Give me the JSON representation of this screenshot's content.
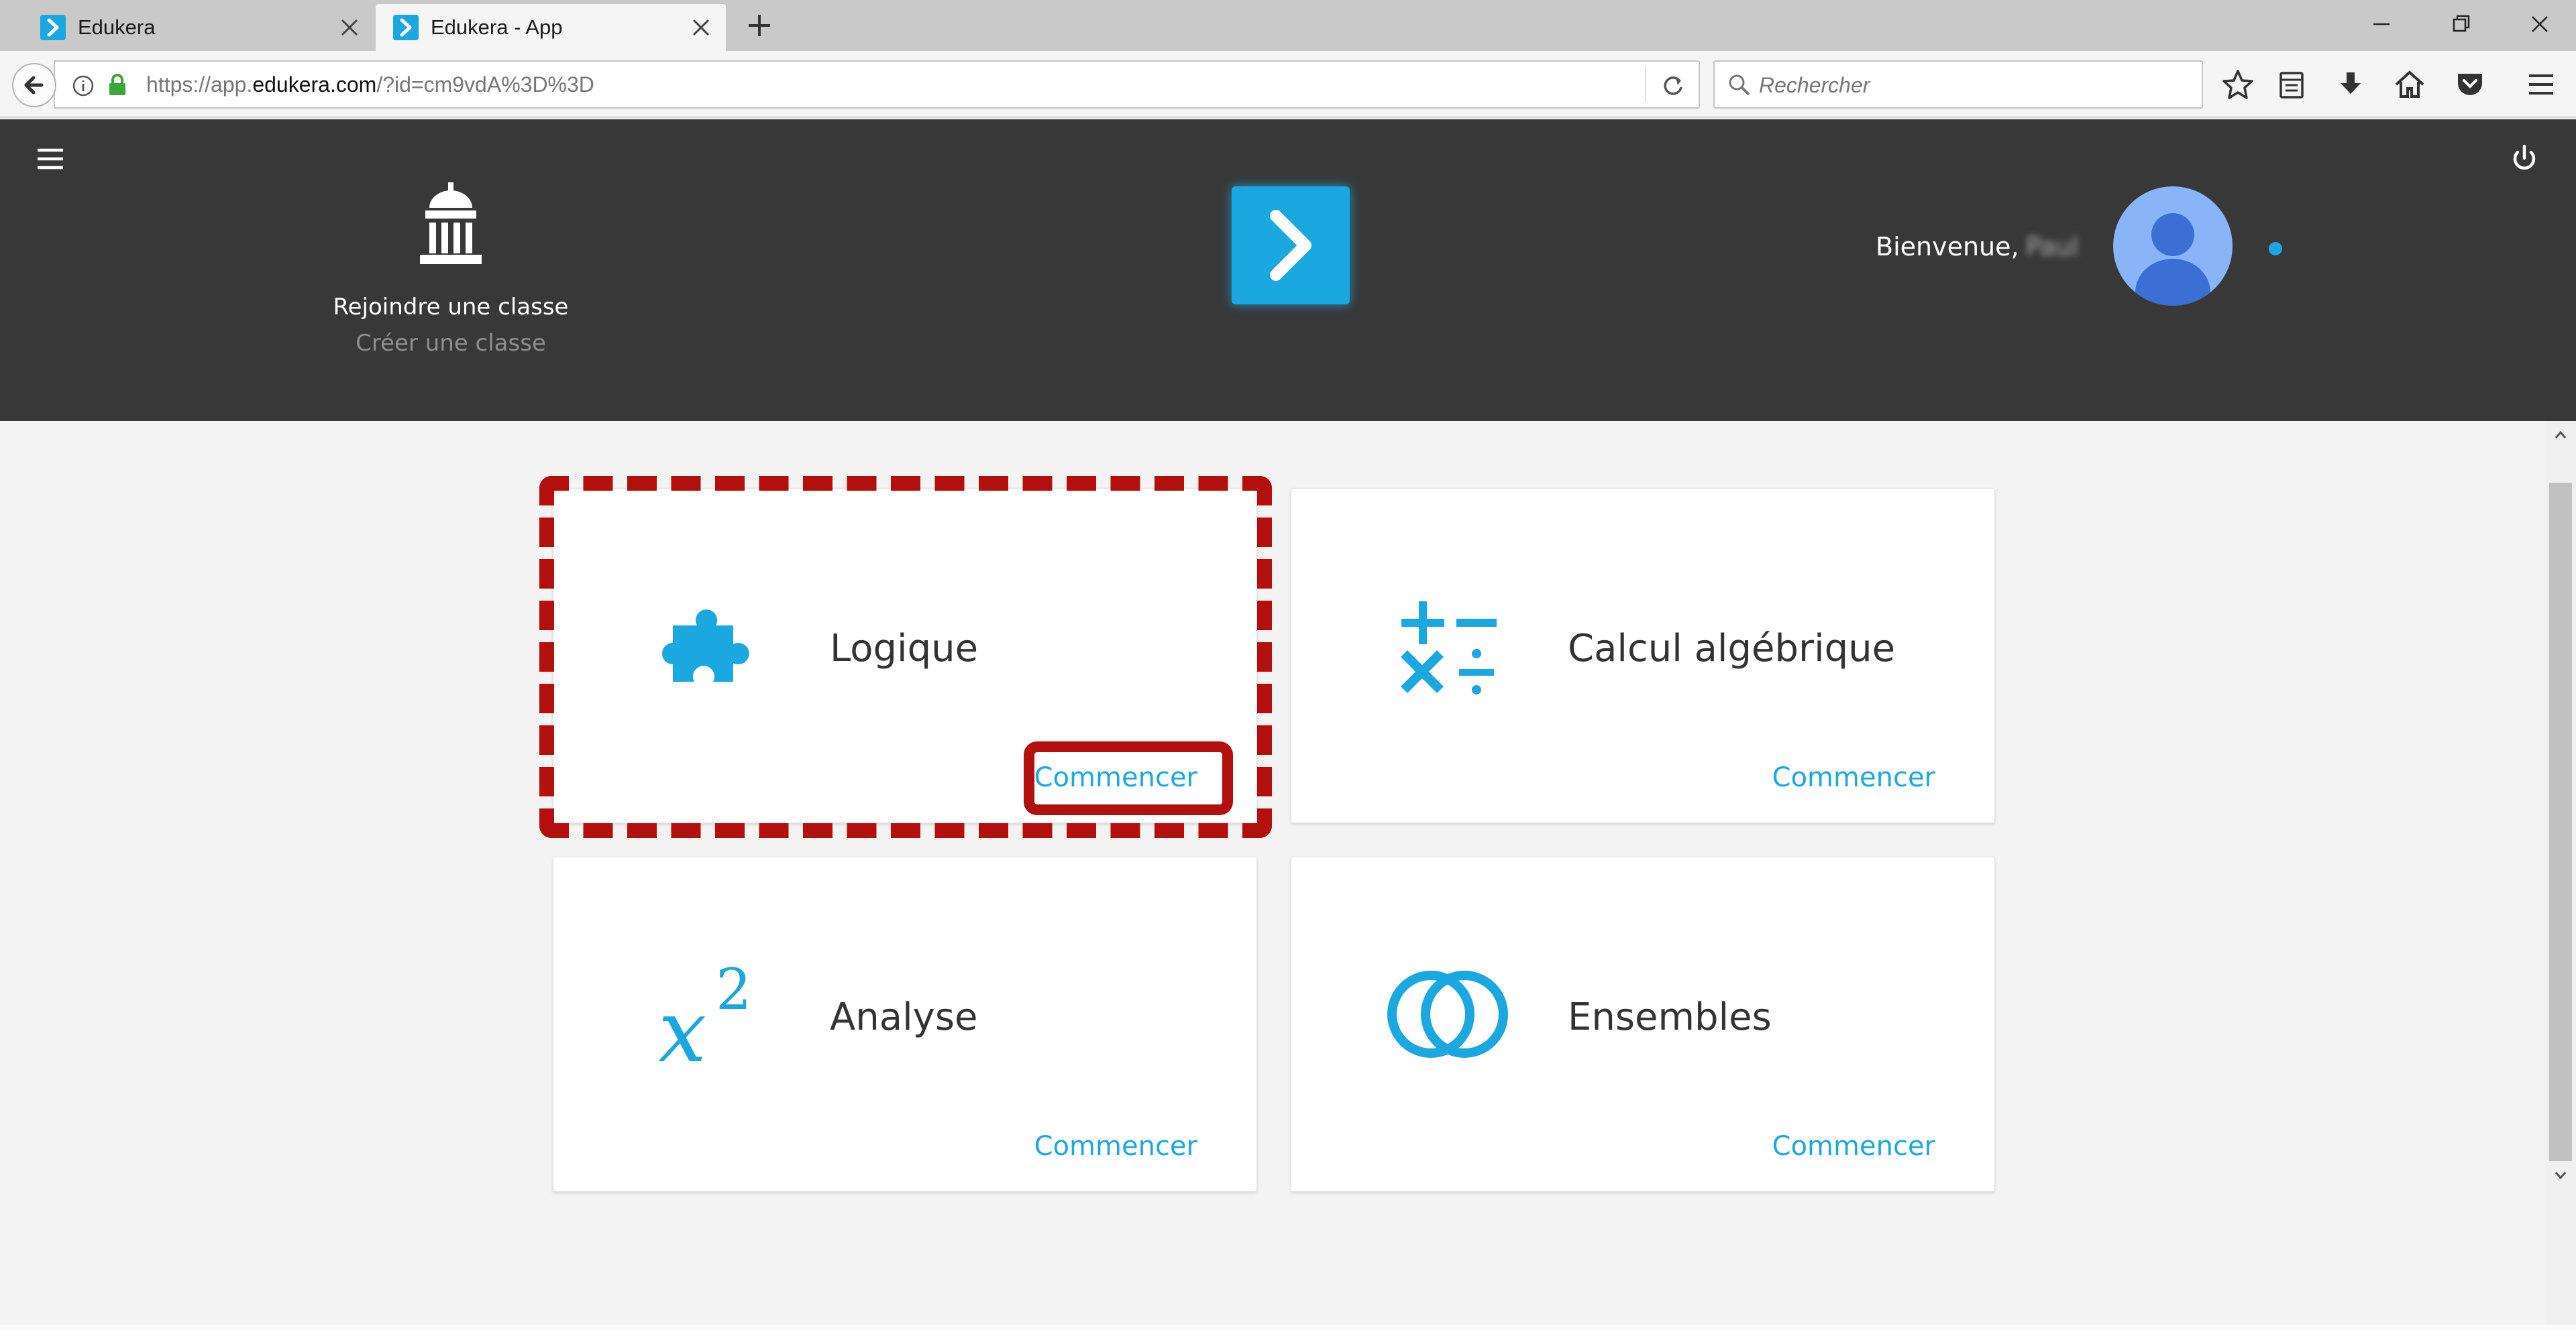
{
  "browser": {
    "tabs": [
      {
        "title": "Edukera",
        "active": false
      },
      {
        "title": "Edukera - App",
        "active": true
      }
    ],
    "url": {
      "prefix": "https://app.",
      "domain": "edukera.com",
      "suffix": "/?id=cm9vdA%3D%3D"
    },
    "search_placeholder": "Rechercher"
  },
  "header": {
    "join_class": "Rejoindre une classe",
    "create_class": "Créer une classe",
    "welcome": "Bienvenue,",
    "user_name": "Paul"
  },
  "subjects": [
    {
      "title": "Logique",
      "action": "Commencer",
      "icon": "puzzle-icon"
    },
    {
      "title": "Calcul algébrique",
      "action": "Commencer",
      "icon": "arithmetic-operators-icon"
    },
    {
      "title": "Analyse",
      "action": "Commencer",
      "icon": "x-squared-icon"
    },
    {
      "title": "Ensembles",
      "action": "Commencer",
      "icon": "sets-rings-icon"
    }
  ],
  "colors": {
    "accent": "#1ba7e0",
    "header_bg": "#383838",
    "highlight": "#b30f0f"
  }
}
